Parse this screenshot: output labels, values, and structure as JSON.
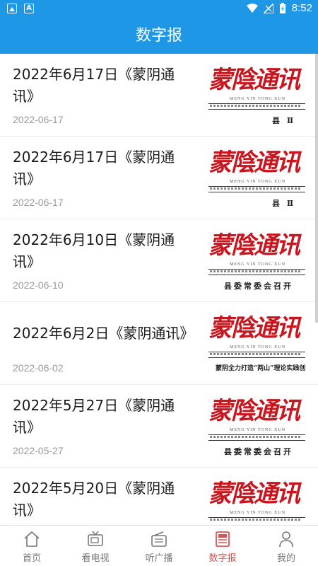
{
  "status_bar": {
    "time": "8:52",
    "left_icons": [
      "image-icon",
      "a-icon"
    ],
    "right_icons": [
      "wifi-icon",
      "signal-icon",
      "battery-icon"
    ]
  },
  "header": {
    "title": "数字报"
  },
  "articles": [
    {
      "title": "2022年6月17日《蒙阴通讯》",
      "date": "2022-06-17",
      "thumb": {
        "masthead": "蒙陰通讯",
        "pinyin": "MENG YIN TONG XUN",
        "headline": "县  Ⅱ"
      }
    },
    {
      "title": "2022年6月17日《蒙阴通讯》",
      "date": "2022-06-17",
      "thumb": {
        "masthead": "蒙陰通讯",
        "pinyin": "MENG YIN TONG XUN",
        "headline": "县  Ⅱ"
      }
    },
    {
      "title": "2022年6月10日《蒙阴通讯》",
      "date": "2022-06-10",
      "thumb": {
        "masthead": "蒙陰通讯",
        "pinyin": "MENG YIN TONG XUN",
        "headline": "县委常委会召开"
      }
    },
    {
      "title": "2022年6月2日《蒙阴通讯》",
      "date": "2022-06-02",
      "thumb": {
        "masthead": "蒙陰通讯",
        "pinyin": "MENG YIN TONG XUN",
        "headline": "蒙阴全力打造“两山”理论实践创"
      }
    },
    {
      "title": "2022年5月27日《蒙阴通讯》",
      "date": "2022-05-27",
      "thumb": {
        "masthead": "蒙陰通讯",
        "pinyin": "MENG YIN TONG XUN",
        "headline": "县委常委会召开"
      }
    },
    {
      "title": "2022年5月20日《蒙阴通讯》",
      "date": "",
      "thumb": {
        "masthead": "蒙陰通讯",
        "pinyin": "MENG YIN TONG XUN",
        "headline": ""
      }
    }
  ],
  "tabs": [
    {
      "label": "首页",
      "icon": "home-icon",
      "active": false
    },
    {
      "label": "看电视",
      "icon": "tv-icon",
      "active": false
    },
    {
      "label": "听广播",
      "icon": "radio-icon",
      "active": false
    },
    {
      "label": "数字报",
      "icon": "newspaper-icon",
      "active": true
    },
    {
      "label": "我的",
      "icon": "user-icon",
      "active": false
    }
  ],
  "colors": {
    "primary": "#1e98e6",
    "active_tab": "#e05050",
    "masthead_red": "#c9151e"
  }
}
